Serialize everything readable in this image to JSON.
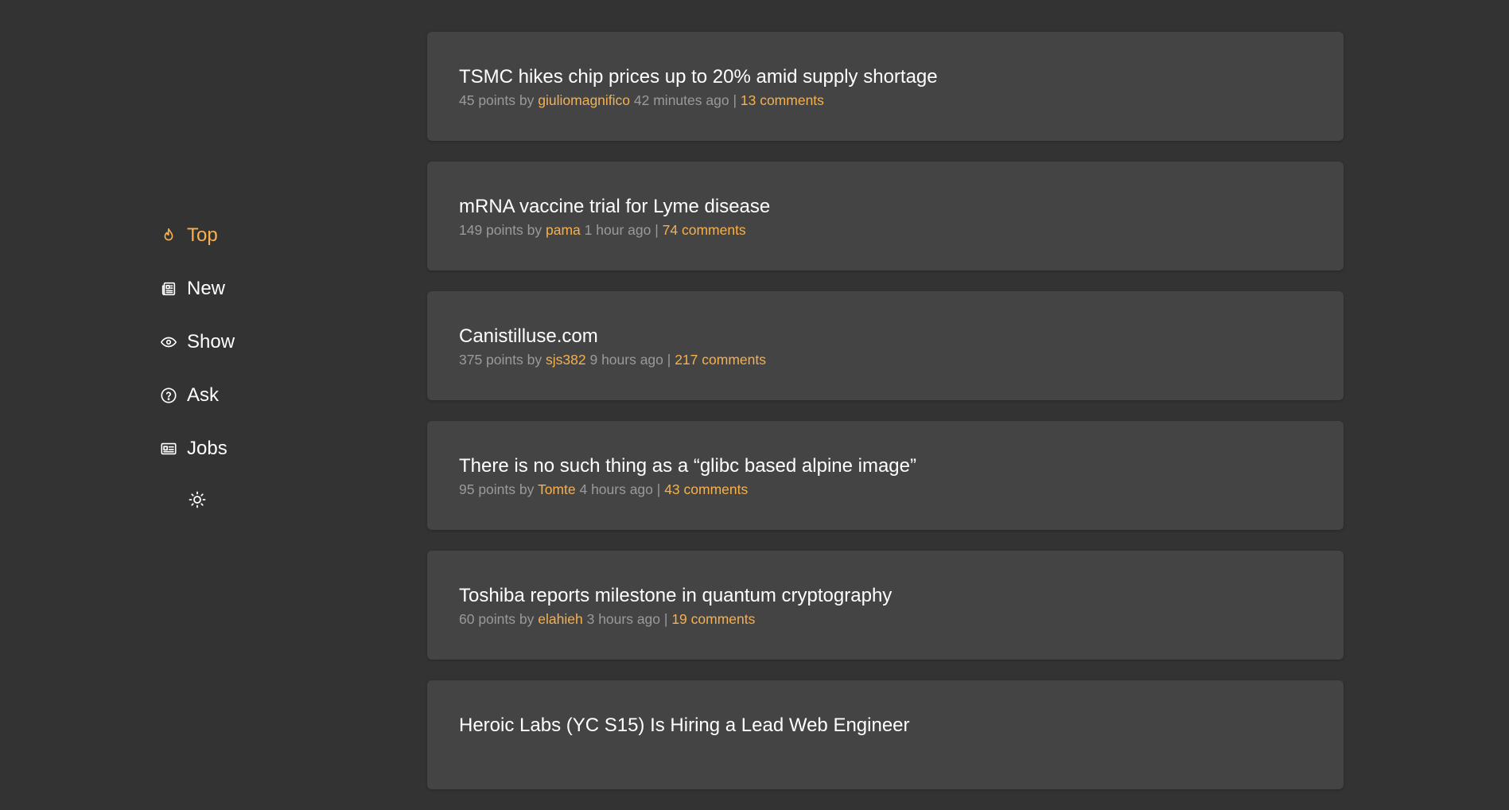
{
  "colors": {
    "background": "#333333",
    "card": "#444444",
    "accent": "#f6b04e",
    "text": "#ffffff",
    "muted": "#9a9a9a"
  },
  "nav": {
    "items": [
      {
        "label": "Top",
        "icon": "flame-icon",
        "active": true
      },
      {
        "label": "New",
        "icon": "newspaper-icon",
        "active": false
      },
      {
        "label": "Show",
        "icon": "eye-icon",
        "active": false
      },
      {
        "label": "Ask",
        "icon": "question-circle-icon",
        "active": false
      },
      {
        "label": "Jobs",
        "icon": "id-card-icon",
        "active": false
      }
    ],
    "theme_toggle_icon": "sun-icon"
  },
  "stories": [
    {
      "title": "TSMC hikes chip prices up to 20% amid supply shortage",
      "points": "45 points",
      "by": "by",
      "author": "giuliomagnifico",
      "time": "42 minutes ago",
      "sep": "|",
      "comments": "13 comments"
    },
    {
      "title": "mRNA vaccine trial for Lyme disease",
      "points": "149 points",
      "by": "by",
      "author": "pama",
      "time": "1 hour ago",
      "sep": "|",
      "comments": "74 comments"
    },
    {
      "title": "Canistilluse.com",
      "points": "375 points",
      "by": "by",
      "author": "sjs382",
      "time": "9 hours ago",
      "sep": "|",
      "comments": "217 comments"
    },
    {
      "title": "There is no such thing as a “glibc based alpine image”",
      "points": "95 points",
      "by": "by",
      "author": "Tomte",
      "time": "4 hours ago",
      "sep": "|",
      "comments": "43 comments"
    },
    {
      "title": "Toshiba reports milestone in quantum cryptography",
      "points": "60 points",
      "by": "by",
      "author": "elahieh",
      "time": "3 hours ago",
      "sep": "|",
      "comments": "19 comments"
    },
    {
      "title": "Heroic Labs (YC S15) Is Hiring a Lead Web Engineer",
      "points": "",
      "by": "",
      "author": "",
      "time": "",
      "sep": "",
      "comments": ""
    }
  ]
}
